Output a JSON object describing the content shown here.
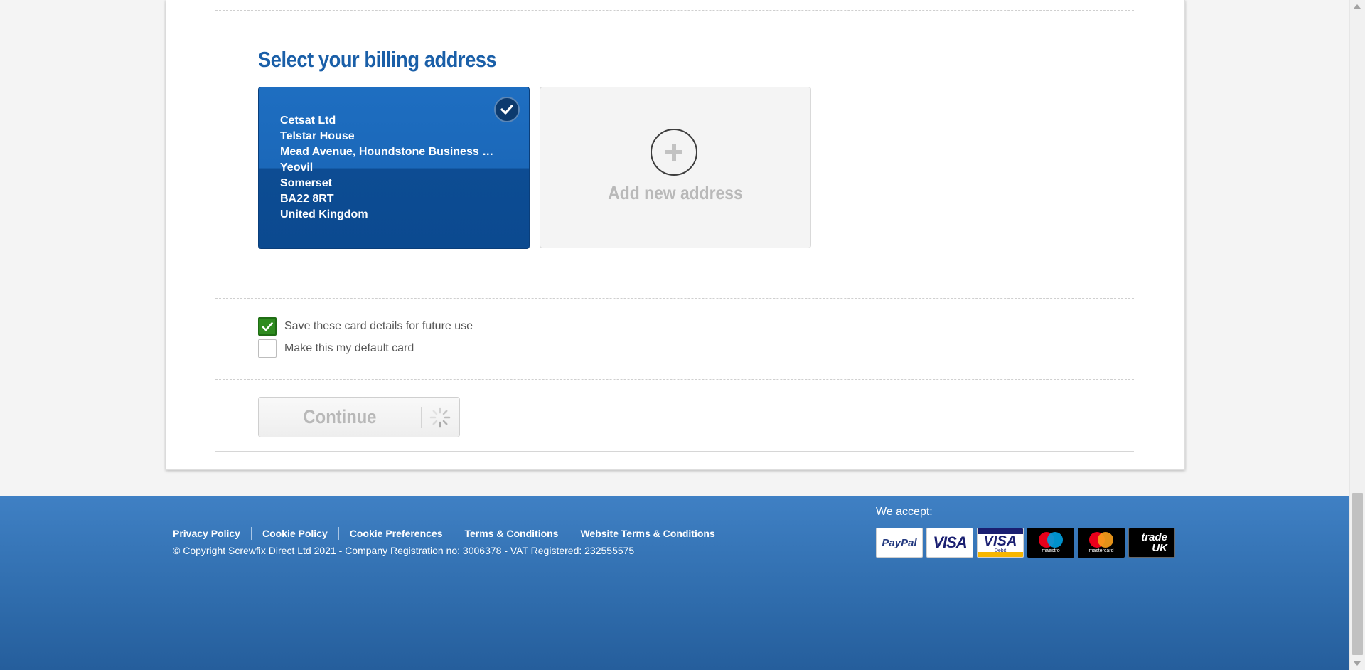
{
  "billing": {
    "title": "Select your billing address",
    "selected_address": {
      "lines": [
        "Cetsat Ltd",
        "Telstar House",
        "Mead Avenue, Houndstone Business …",
        "Yeovil",
        "Somerset",
        "BA22 8RT",
        "United Kingdom"
      ],
      "selected": true
    },
    "add_new_label": "Add new address"
  },
  "options": {
    "save_card_label": "Save these card details for future use",
    "save_card_checked": true,
    "default_card_label": "Make this my default card",
    "default_card_checked": false
  },
  "continue_button": {
    "label": "Continue",
    "loading": true
  },
  "footer": {
    "links": [
      "Privacy Policy",
      "Cookie Policy",
      "Cookie Preferences",
      "Terms & Conditions",
      "Website Terms & Conditions"
    ],
    "copyright": "© Copyright Screwfix Direct Ltd 2021 - Company Registration no: 3006378 - VAT Registered: 232555575",
    "we_accept_label": "We accept:",
    "payment_methods": [
      {
        "name": "paypal-logo",
        "text": "PayPal"
      },
      {
        "name": "visa-logo",
        "text": "VISA"
      },
      {
        "name": "visa-debit-logo",
        "text": "VISA",
        "subtext": "Debit"
      },
      {
        "name": "maestro-logo",
        "text": "maestro"
      },
      {
        "name": "mastercard-logo",
        "text": "mastercard"
      },
      {
        "name": "trade-uk-logo",
        "text": "trade UK"
      }
    ]
  },
  "colors": {
    "accent": "#1a5fa8",
    "selected_card": "#0d4c93",
    "checkbox_checked": "#2e8b1f",
    "footer": "#2f6cac"
  }
}
